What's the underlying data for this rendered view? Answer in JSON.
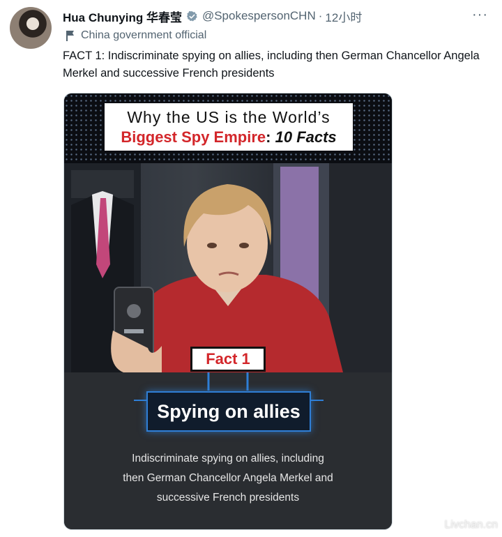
{
  "header": {
    "name": "Hua Chunying 华春莹",
    "handle": "@SpokespersonCHN",
    "separator": "·",
    "time": "12小时",
    "more_label": "···"
  },
  "label": {
    "text": "China government official"
  },
  "tweet": {
    "text": "FACT 1: Indiscriminate spying on allies, including then German Chancellor Angela Merkel and successive French presidents"
  },
  "card": {
    "title_line1": "Why the US is the World’s",
    "title_red": "Biggest Spy Empire",
    "title_colon": ":",
    "title_black": "10 Facts",
    "fact_label": "Fact 1",
    "headline": "Spying on allies",
    "caption_lines": [
      "Indiscriminate spying on allies, including",
      "then German Chancellor Angela Merkel and",
      "successive French presidents"
    ]
  },
  "watermark": "Livchan.cn",
  "colors": {
    "text": "#0f1419",
    "muted": "#536471",
    "verified": "#829aab",
    "accent_red": "#d3262a",
    "accent_blue": "#2f7fd6"
  },
  "icons": {
    "verified": "verified-badge-icon",
    "flag": "government-flag-icon",
    "more": "more-dots-icon"
  }
}
